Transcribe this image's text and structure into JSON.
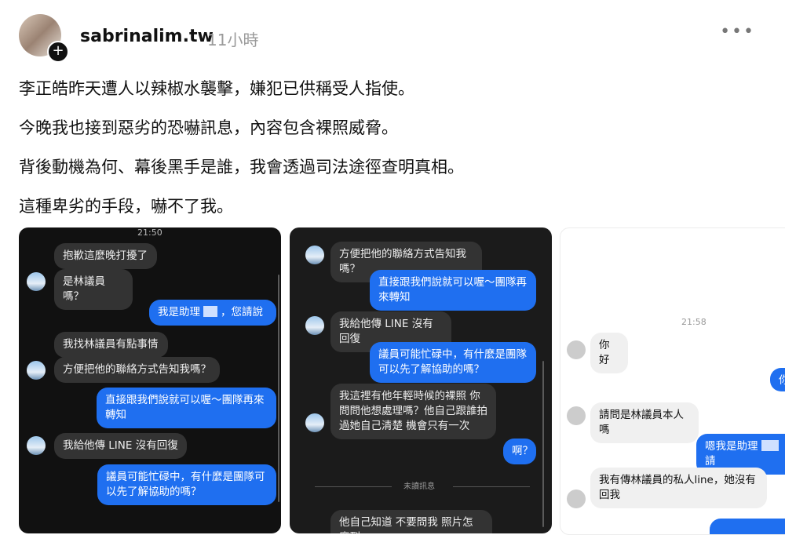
{
  "post": {
    "username": "sabrinalim.tw",
    "time": "11小時",
    "more": "•••",
    "lines": [
      "李正皓昨天遭人以辣椒水襲擊，嫌犯已供稱受人指使。",
      "今晚我也接到惡劣的恐嚇訊息，內容包含裸照威脅。",
      "背後動機為何、幕後黑手是誰，我會透過司法途徑查明真相。",
      "這種卑劣的手段，嚇不了我。"
    ]
  },
  "shot1": {
    "time": "21:50",
    "messages": [
      "抱歉這麼晚打擾了",
      "是林議員嗎？",
      "我是助理",
      "，您請說",
      "我找林議員有點事情",
      "方便把他的聯絡方式告知我嗎？",
      "直接跟我們說就可以喔～團隊再來轉知",
      "我給他傳 LINE 沒有回復",
      "議員可能忙碌中，有什麼是團隊可以先了解協助的嗎？"
    ]
  },
  "shot2": {
    "messages": [
      "方便把他的聯絡方式告知我嗎？",
      "直接跟我們說就可以喔～團隊再來轉知",
      "我給他傳 LINE 沒有回復",
      "議員可能忙碌中，有什麼是團隊可以先了解協助的嗎？",
      "我這裡有他年輕時候的裸照  你問問他想處理嗎？他自己跟誰拍過她自己清楚  機會只有一次",
      "啊？",
      "他自己知道 不要問我 照片怎麼到"
    ],
    "unread": "未讀訊息"
  },
  "shot3": {
    "time": "21:58",
    "messages": [
      "你好",
      "你",
      "請問是林議員本人嗎",
      "嗯我是助理",
      "請",
      "我有傳林議員的私人line，她沒有回我"
    ]
  }
}
